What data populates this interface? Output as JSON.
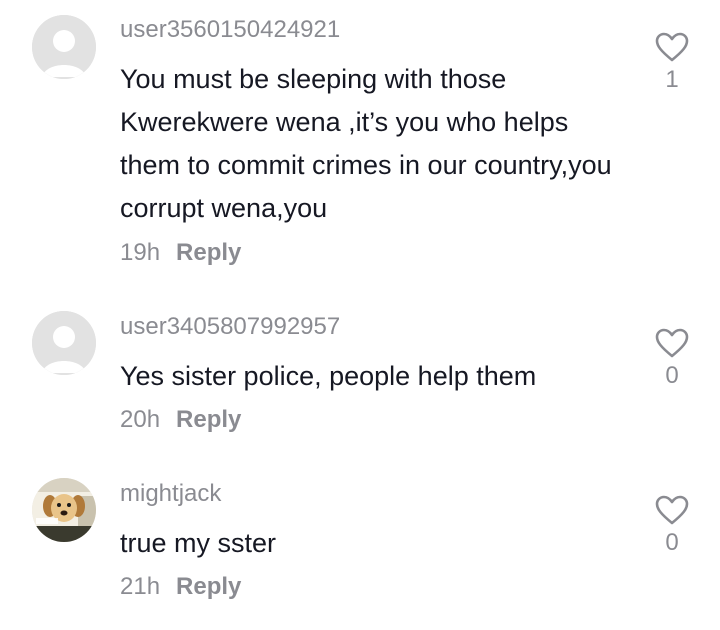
{
  "comments": [
    {
      "username": "user3560150424921",
      "text": "You must be sleeping with those Kwerekwere wena ,it’s you who helps them to commit crimes in our country,you corrupt wena,you",
      "time": "19h",
      "reply_label": "Reply",
      "likes": "1",
      "avatar": "default-avatar-icon"
    },
    {
      "username": "user3405807992957",
      "text": "Yes sister police, people help them",
      "time": "20h",
      "reply_label": "Reply",
      "likes": "0",
      "avatar": "default-avatar-icon"
    },
    {
      "username": "mightjack",
      "text": "true my sster",
      "time": "21h",
      "reply_label": "Reply",
      "likes": "0",
      "avatar": "dog-photo-avatar"
    }
  ],
  "colors": {
    "secondary_text": "#8a8b91",
    "primary_text": "#161823",
    "heart_stroke": "#8a8b91"
  }
}
